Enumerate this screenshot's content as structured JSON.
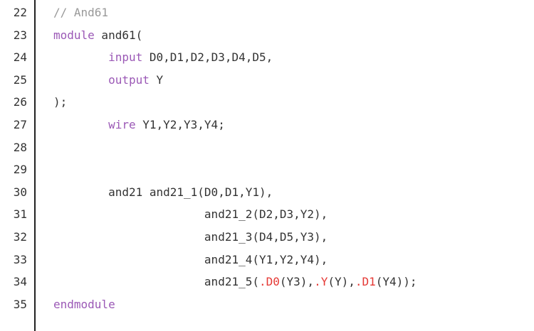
{
  "lines": [
    {
      "num": "22",
      "tokens": [
        {
          "t": "// And61",
          "c": "cm"
        }
      ]
    },
    {
      "num": "23",
      "tokens": [
        {
          "t": "module",
          "c": "kw"
        },
        {
          "t": " and61(",
          "c": "tx"
        }
      ]
    },
    {
      "num": "24",
      "tokens": [
        {
          "t": "        ",
          "c": "tx"
        },
        {
          "t": "input",
          "c": "kw"
        },
        {
          "t": " D0,D1,D2,D3,D4,D5,",
          "c": "tx"
        }
      ]
    },
    {
      "num": "25",
      "tokens": [
        {
          "t": "        ",
          "c": "tx"
        },
        {
          "t": "output",
          "c": "kw"
        },
        {
          "t": " Y",
          "c": "tx"
        }
      ]
    },
    {
      "num": "26",
      "tokens": [
        {
          "t": ");",
          "c": "tx"
        }
      ]
    },
    {
      "num": "27",
      "tokens": [
        {
          "t": "        ",
          "c": "tx"
        },
        {
          "t": "wire",
          "c": "kw"
        },
        {
          "t": " Y1,Y2,Y3,Y4;",
          "c": "tx"
        }
      ]
    },
    {
      "num": "28",
      "tokens": []
    },
    {
      "num": "29",
      "tokens": []
    },
    {
      "num": "30",
      "tokens": [
        {
          "t": "        and21 and21_1(D0,D1,Y1),",
          "c": "tx"
        }
      ]
    },
    {
      "num": "31",
      "tokens": [
        {
          "t": "                      and21_2(D2,D3,Y2),",
          "c": "tx"
        }
      ]
    },
    {
      "num": "32",
      "tokens": [
        {
          "t": "                      and21_3(D4,D5,Y3),",
          "c": "tx"
        }
      ]
    },
    {
      "num": "33",
      "tokens": [
        {
          "t": "                      and21_4(Y1,Y2,Y4),",
          "c": "tx"
        }
      ]
    },
    {
      "num": "34",
      "tokens": [
        {
          "t": "                      and21_5(",
          "c": "tx"
        },
        {
          "t": ".D0",
          "c": "port"
        },
        {
          "t": "(Y3),",
          "c": "tx"
        },
        {
          "t": ".Y",
          "c": "port"
        },
        {
          "t": "(Y),",
          "c": "tx"
        },
        {
          "t": ".D1",
          "c": "port"
        },
        {
          "t": "(Y4));",
          "c": "tx"
        }
      ]
    },
    {
      "num": "35",
      "tokens": [
        {
          "t": "endmodule",
          "c": "kw"
        }
      ]
    }
  ],
  "colors": {
    "keyword": "#9b59b6",
    "comment": "#999999",
    "port": "#e53935",
    "text": "#333333",
    "gutter_border": "#222222"
  }
}
